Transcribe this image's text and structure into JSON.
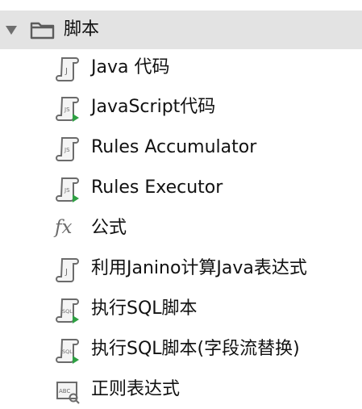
{
  "header": {
    "label": "脚本",
    "disclosure_icon": "triangle-down-icon",
    "folder_icon": "folder-icon",
    "background": "#e3e3e3"
  },
  "items": [
    {
      "label": "Java 代码",
      "icon": "script-icon"
    },
    {
      "label": "JavaScript代码",
      "icon": "script-run-icon"
    },
    {
      "label": "Rules Accumulator",
      "icon": "script-icon"
    },
    {
      "label": "Rules Executor",
      "icon": "script-run-icon"
    },
    {
      "label": "公式",
      "icon": "fx-icon"
    },
    {
      "label": "利用Janino计算Java表达式",
      "icon": "script-icon"
    },
    {
      "label": "执行SQL脚本",
      "icon": "sql-script-icon"
    },
    {
      "label": "执行SQL脚本(字段流替换)",
      "icon": "sql-script-icon"
    },
    {
      "label": "正则表达式",
      "icon": "regex-icon"
    }
  ],
  "colors": {
    "icon_gray": "#6e6e6e",
    "run_green": "#2ea043",
    "text": "#111111"
  }
}
